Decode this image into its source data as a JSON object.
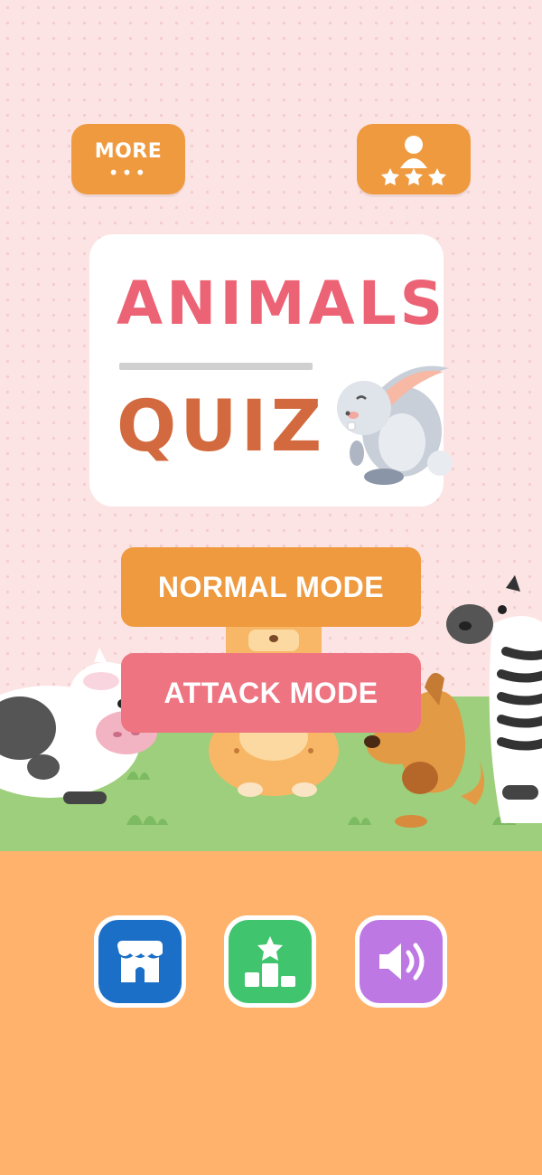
{
  "header": {
    "more_label": "MORE",
    "more_dots": "•••",
    "more_icon": "dots-icon",
    "leaderboard_icon": "user-stars-icon"
  },
  "title": {
    "line1": "ANIMALS",
    "line2": "QUIZ",
    "mascot": "rabbit"
  },
  "modes": {
    "normal_label": "NORMAL MODE",
    "attack_label": "ATTACK MODE"
  },
  "bottom_bar": [
    {
      "icon": "shop-icon",
      "color": "#1b6fc6"
    },
    {
      "icon": "podium-star-icon",
      "color": "#41c46e"
    },
    {
      "icon": "speaker-icon",
      "color": "#bd78e3"
    }
  ],
  "colors": {
    "background": "#fce4e4",
    "orange": "#ef9a3f",
    "pink": "#ee7482",
    "grass": "#9ecf7c",
    "ground": "#ffb26b"
  }
}
